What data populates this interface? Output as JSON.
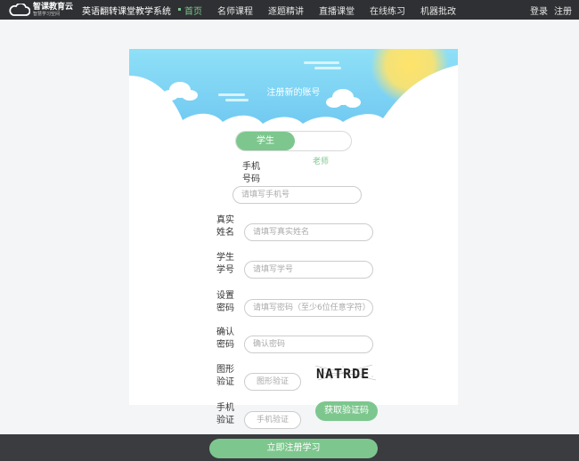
{
  "header": {
    "logo_main": "智课教育云",
    "logo_sub": "智慧学习空间",
    "system_title": "英语翻转课堂教学系统",
    "nav": [
      {
        "label": "首页",
        "active": true
      },
      {
        "label": "名师课程",
        "active": false
      },
      {
        "label": "逐题精讲",
        "active": false
      },
      {
        "label": "直播课堂",
        "active": false
      },
      {
        "label": "在线练习",
        "active": false
      },
      {
        "label": "机器批改",
        "active": false
      }
    ],
    "login": "登录",
    "register": "注册"
  },
  "register": {
    "title": "注册新的账号",
    "role_student": "学生",
    "role_teacher": "老师",
    "phone": {
      "label": "手机号码",
      "placeholder": "请填写手机号"
    },
    "name": {
      "label": "真实姓名",
      "placeholder": "请填写真实姓名"
    },
    "student_id": {
      "label": "学生学号",
      "placeholder": "请填写学号"
    },
    "password": {
      "label": "设置密码",
      "placeholder": "请填写密码（至少6位任意字符）"
    },
    "confirm": {
      "label": "确认密码",
      "placeholder": "确认密码"
    },
    "captcha": {
      "label": "图形验证",
      "placeholder": "图形验证",
      "image_text": "NATRDE"
    },
    "sms": {
      "label": "手机验证",
      "placeholder": "手机验证"
    },
    "get_code_button": "获取验证码",
    "submit_button": "立即注册学习"
  },
  "colors": {
    "accent_green": "#7dc78e",
    "topbar": "#2f3033",
    "sky": "#7fd3f3"
  }
}
